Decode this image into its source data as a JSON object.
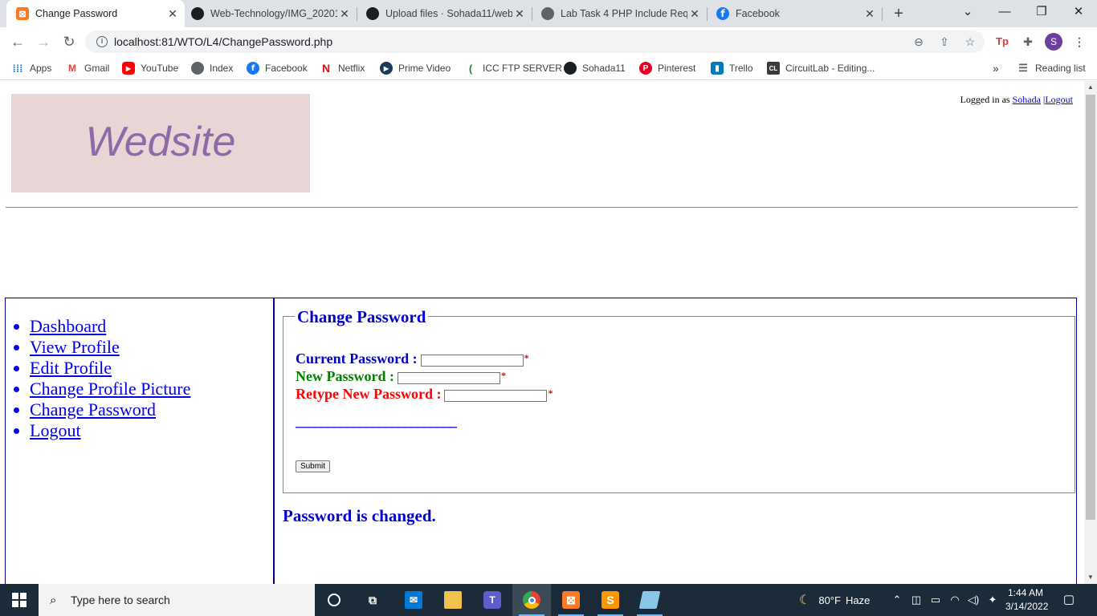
{
  "browser": {
    "tabs": [
      {
        "title": "Change Password",
        "icon": "xampp-icon",
        "active": true
      },
      {
        "title": "Web-Technology/IMG_20201",
        "icon": "github-icon"
      },
      {
        "title": "Upload files · Sohada11/web",
        "icon": "github-icon"
      },
      {
        "title": "Lab Task 4 PHP Include Requ",
        "icon": "globe-icon"
      },
      {
        "title": "Facebook",
        "icon": "facebook-icon"
      }
    ],
    "new_tab_label": "+",
    "url": "localhost:81/WTO/L4/ChangePassword.php",
    "profile_initial": "S",
    "extension_badge": "Tp",
    "bookmarks": [
      {
        "label": "Apps"
      },
      {
        "label": "Gmail"
      },
      {
        "label": "YouTube"
      },
      {
        "label": "Index"
      },
      {
        "label": "Facebook"
      },
      {
        "label": "Netflix"
      },
      {
        "label": "Prime Video"
      },
      {
        "label": "ICC FTP SERVER"
      },
      {
        "label": "Sohada11"
      },
      {
        "label": "Pinterest"
      },
      {
        "label": "Trello"
      },
      {
        "label": "CircuitLab - Editing..."
      }
    ],
    "bookmarks_overflow": "»",
    "reading_list": "Reading list"
  },
  "page": {
    "logo_text": "Wedsite",
    "login": {
      "prefix": "Logged in as",
      "username": "Sohada",
      "separator": "|",
      "logout": "Logout"
    },
    "nav": [
      {
        "label": "Dashboard"
      },
      {
        "label": "View Profile"
      },
      {
        "label": "Edit Profile"
      },
      {
        "label": "Change Profile Picture"
      },
      {
        "label": "Change Password"
      },
      {
        "label": "Logout"
      }
    ],
    "form": {
      "legend": "Change Password",
      "fields": [
        {
          "label": "Current Password :",
          "value": "",
          "required_mark": "*",
          "color": "#0000cd"
        },
        {
          "label": "New Password :",
          "value": "",
          "required_mark": "*",
          "color": "#008000"
        },
        {
          "label": "Retype New Password :",
          "value": "",
          "required_mark": "*",
          "color": "#ff0000"
        }
      ],
      "divider": "_________________________",
      "submit": "Submit"
    },
    "status": "Password is changed."
  },
  "taskbar": {
    "search_placeholder": "Type here to search",
    "weather": {
      "temp": "80°F",
      "condition": "Haze"
    },
    "time": "1:44 AM",
    "date": "3/14/2022"
  }
}
